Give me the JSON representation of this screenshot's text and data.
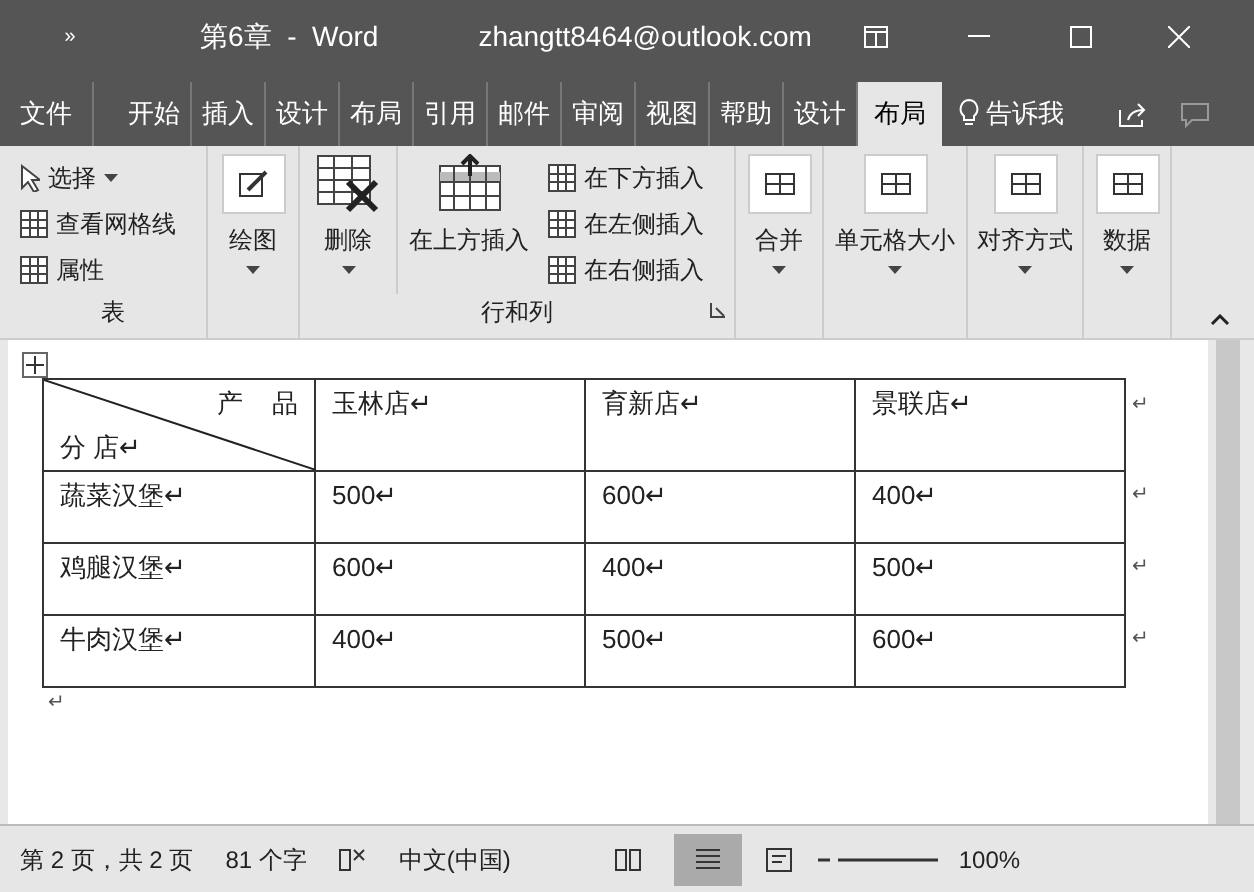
{
  "title_bar": {
    "quick_access": "»",
    "title": "第6章  -  Word",
    "account": "zhangtt8464@outlook.com"
  },
  "tabs": [
    {
      "label": "文件",
      "selected": false
    },
    {
      "label": "开始",
      "selected": false
    },
    {
      "label": "插入",
      "selected": false
    },
    {
      "label": "设计",
      "selected": false
    },
    {
      "label": "布局",
      "selected": false
    },
    {
      "label": "引用",
      "selected": false
    },
    {
      "label": "邮件",
      "selected": false
    },
    {
      "label": "审阅",
      "selected": false
    },
    {
      "label": "视图",
      "selected": false
    },
    {
      "label": "帮助",
      "selected": false
    },
    {
      "label": "设计",
      "selected": false
    },
    {
      "label": "布局",
      "selected": true
    }
  ],
  "tell_me": "告诉我",
  "ribbon": {
    "table_group": {
      "items": [
        "选择",
        "查看网格线",
        "属性"
      ],
      "label": "表"
    },
    "draw": "绘图",
    "delete": "删除",
    "insert_above": "在上方插入",
    "insert_side": [
      "在下方插入",
      "在左侧插入",
      "在右侧插入"
    ],
    "rows_cols_label": "行和列",
    "big_buttons": [
      "合并",
      "单元格大小",
      "对齐方式",
      "数据"
    ]
  },
  "table": {
    "corner_top": "产    品",
    "corner_bottom": "分 店↵",
    "columns": [
      "玉林店↵",
      "育新店↵",
      "景联店↵"
    ],
    "rows": [
      {
        "label": "蔬菜汉堡↵",
        "cells": [
          "500↵",
          "600↵",
          "400↵"
        ]
      },
      {
        "label": "鸡腿汉堡↵",
        "cells": [
          "600↵",
          "400↵",
          "500↵"
        ]
      },
      {
        "label": "牛肉汉堡↵",
        "cells": [
          "400↵",
          "500↵",
          "600↵"
        ]
      }
    ],
    "row_end_mark": "↵",
    "after_mark": "↵"
  },
  "status_bar": {
    "page": "第 2 页，共 2 页",
    "words": "81 个字",
    "language": "中文(中国)",
    "zoom": "100%"
  }
}
